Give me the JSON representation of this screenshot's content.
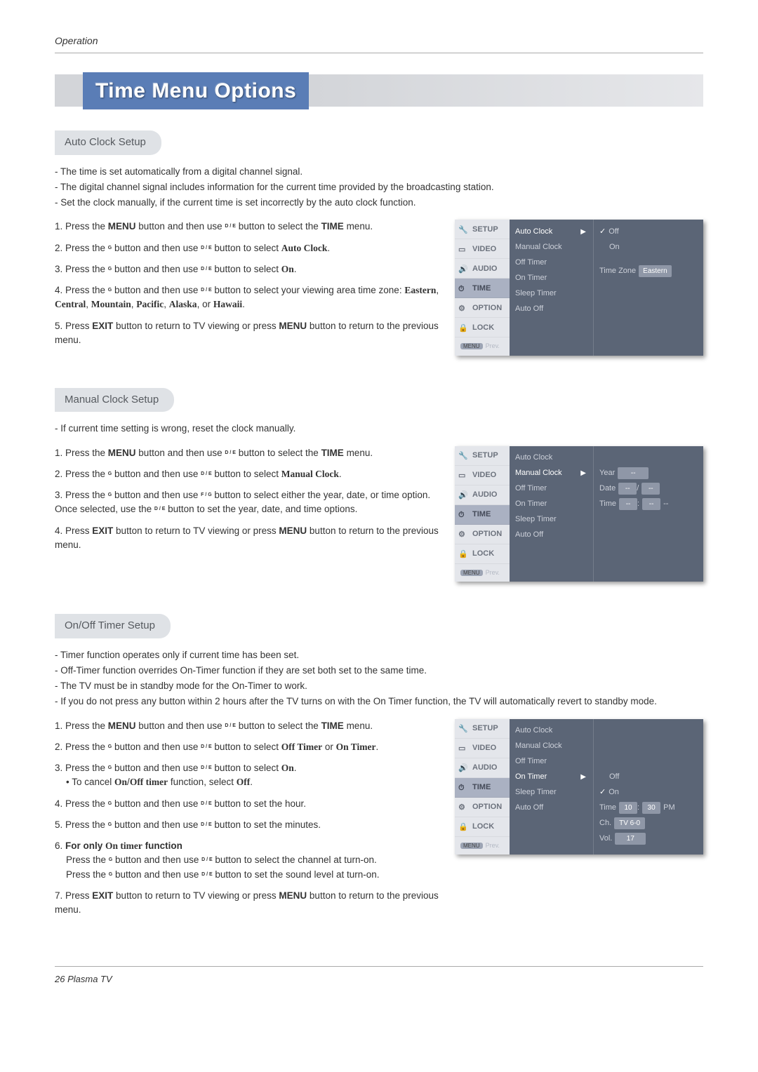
{
  "header_label": "Operation",
  "page_title": "Time Menu Options",
  "s1": {
    "label": "Auto Clock Setup",
    "notes": [
      "-   The time is set automatically from a digital channel signal.",
      "-   The digital channel signal includes information for the current time provided by the broadcasting station.",
      "-   Set the clock manually, if the current time is set incorrectly by the auto clock function."
    ],
    "steps": {
      "1a": "1. Press the ",
      "1b": "MENU",
      "1c": " button and then use ",
      "1d": "D  / E",
      "1e": "  button to select the ",
      "1f": "TIME",
      "1g": " menu.",
      "2a": "2. Press the ",
      "2b": "G",
      "2c": "  button and then use ",
      "2d": "D  / E",
      "2e": "  button to select ",
      "2f": "Auto Clock",
      "2g": ".",
      "3a": "3. Press the ",
      "3b": "G",
      "3c": "  button and then use ",
      "3d": "D   / E",
      "3e": "  button to select ",
      "3f": "On",
      "3g": ".",
      "4a": "4. Press the ",
      "4b": "G",
      "4c": "  button and then use ",
      "4d": "D   / E",
      "4e": "  button to select your viewing area time zone: ",
      "4f": "Eastern",
      "4g": ", ",
      "4h": "Central",
      "4i": ", ",
      "4j": "Mountain",
      "4k": ", ",
      "4l": "Pacific",
      "4m": ", ",
      "4n": "Alaska",
      "4o": ", or ",
      "4p": "Hawaii",
      "4q": ".",
      "5a": "5. Press ",
      "5b": "EXIT",
      "5c": " button to return to TV viewing or press ",
      "5d": "MENU",
      "5e": " button to return to the previous menu."
    }
  },
  "s2": {
    "label": "Manual Clock Setup",
    "notes": [
      "-   If current time setting is wrong, reset the clock manually."
    ],
    "steps": {
      "1a": "1. Press the ",
      "1b": "MENU",
      "1c": " button and then use ",
      "1d": "D  / E",
      "1e": "  button to select the ",
      "1f": "TIME",
      "1g": " menu.",
      "2a": "2. Press the ",
      "2b": "G",
      "2c": "  button and then use ",
      "2d": "D  / E",
      "2e": "  button to select ",
      "2f": "Manual Clock",
      "2g": ".",
      "3a": "3. Press the ",
      "3b": "G",
      "3c": "  button and then use ",
      "3d": "F  / G",
      "3e": "  button to select either the year, date, or time option. Once selected, use the ",
      "3f": "D  / E",
      "3g": "  button to set the year, date, and time options.",
      "4a": "4. Press ",
      "4b": "EXIT",
      "4c": " button to return to TV viewing or press ",
      "4d": "MENU",
      "4e": " button to return to the previous menu."
    }
  },
  "s3": {
    "label": "On/Off Timer Setup",
    "notes": [
      "-   Timer function operates only if current time has been set.",
      "-   Off-Timer function overrides On-Timer function if they are set both set to the same time.",
      "-   The TV must be in standby mode for the On-Timer to work.",
      "-   If you do not press any button within 2 hours after the TV turns on with the On Timer function, the TV will automatically revert to standby mode."
    ],
    "steps": {
      "1a": "1. Press the ",
      "1b": "MENU",
      "1c": " button and then use ",
      "1d": "D  / E",
      "1e": "  button to select the ",
      "1f": "TIME",
      "1g": " menu.",
      "2a": "2. Press the ",
      "2b": "G",
      "2c": "  button and then use ",
      "2d": "D  / E",
      "2e": "  button to select ",
      "2f": "Off Timer",
      "2g": " or ",
      "2h": "On Timer",
      "2i": ".",
      "3a": "3. Press the ",
      "3b": "G",
      "3c": "  button and then use ",
      "3d": "D  / E",
      "3e": "  button to select ",
      "3f": "On",
      "3g": ".",
      "3ha": "• To cancel ",
      "3hb": "On",
      "3hc": "/",
      "3hd": "Off timer",
      "3he": " function, select ",
      "3hf": "Off",
      "3hg": ".",
      "4a": "4. Press the ",
      "4b": "G",
      "4c": "  button and then use ",
      "4d": "D  / E",
      "4e": "  button to set the hour.",
      "5a": "5. Press the ",
      "5b": "G",
      "5c": "  button and then use ",
      "5d": "D  / E",
      "5e": "  button to set the minutes.",
      "6a": "6. ",
      "6b": "For only ",
      "6c": "On timer",
      "6d": " function",
      "6e": "Press the ",
      "6f": "G",
      "6g": "  button and then use ",
      "6h": "D  / E",
      "6i": "  button to select the channel at turn-on.",
      "6j": "Press the ",
      "6k": "G",
      "6l": "  button and then use ",
      "6m": "D  / E",
      "6n": "  button to set the sound level at turn-on.",
      "7a": "7. Press ",
      "7b": "EXIT",
      "7c": " button to return to TV viewing or press ",
      "7d": "MENU",
      "7e": " button to return to the previous menu."
    }
  },
  "osd": {
    "nav": {
      "setup": "SETUP",
      "video": "VIDEO",
      "audio": "AUDIO",
      "time": "TIME",
      "option": "OPTION",
      "lock": "LOCK"
    },
    "items": {
      "auto_clock": "Auto Clock",
      "manual_clock": "Manual Clock",
      "off_timer": "Off Timer",
      "on_timer": "On Timer",
      "sleep_timer": "Sleep Timer",
      "auto_off": "Auto Off"
    },
    "foot_menu": "MENU",
    "foot_prev": "Prev.",
    "p1": {
      "off": "Off",
      "on": "On",
      "timezone": "Time Zone",
      "tz_val": "Eastern"
    },
    "p2": {
      "year": "Year",
      "date": "Date",
      "time": "Time",
      "dash": "--",
      "slash": "/",
      "colon": ":"
    },
    "p3": {
      "off": "Off",
      "on": "On",
      "time": "Time",
      "ch": "Ch.",
      "vol": "Vol.",
      "h": "10",
      "m": "30",
      "pm": "PM",
      "chval": "TV 6-0",
      "volval": "17",
      "colon": ":"
    }
  },
  "footer": "26 Plasma TV"
}
